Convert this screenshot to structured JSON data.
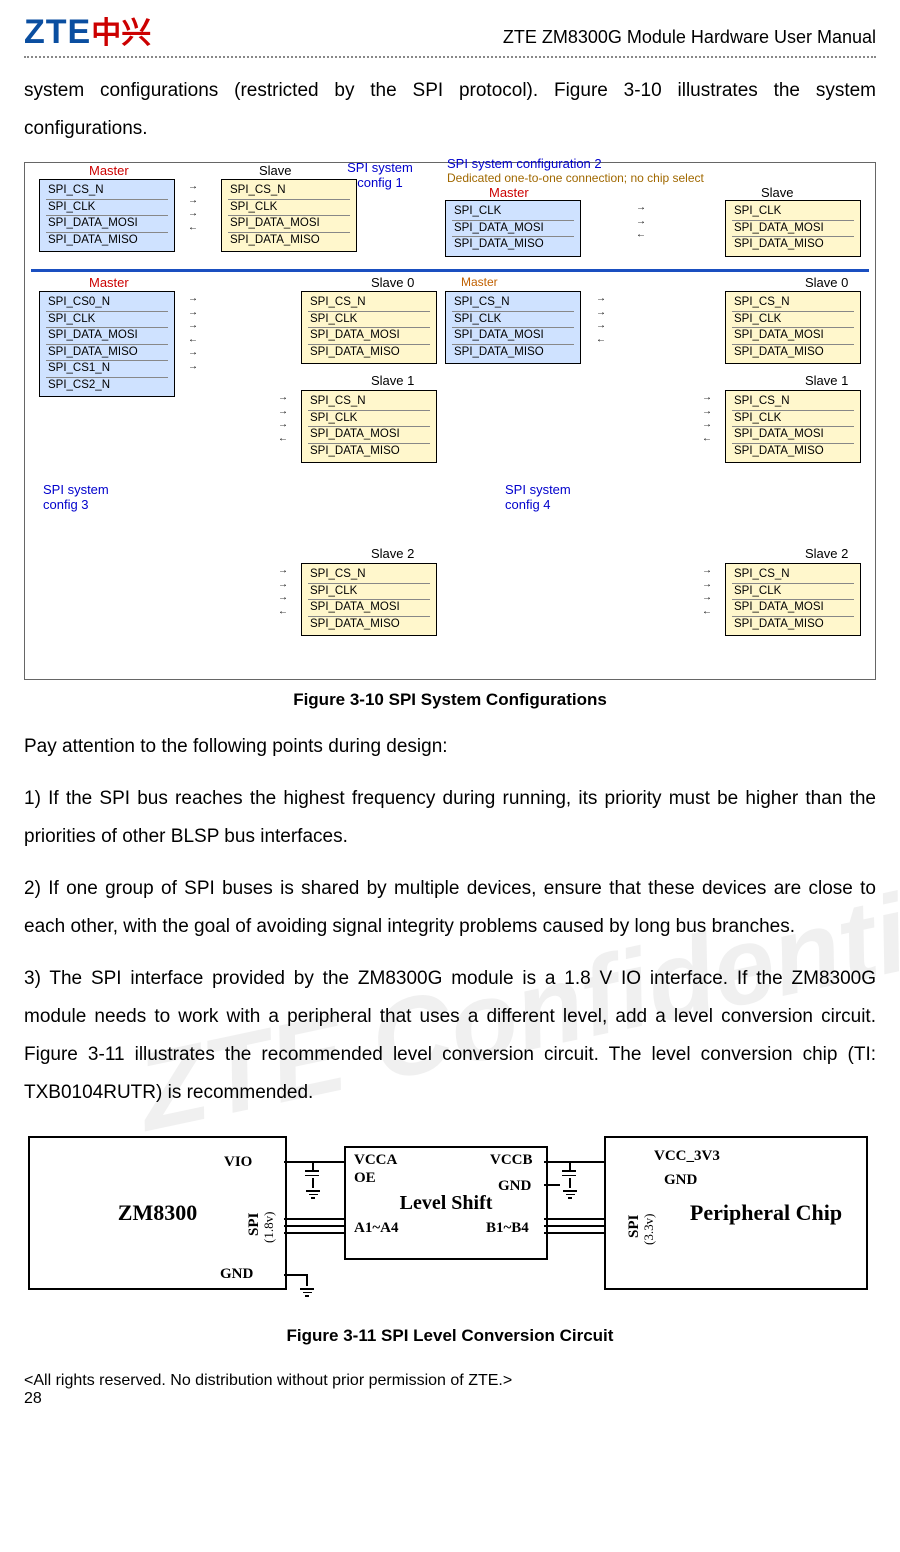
{
  "header": {
    "logo_latin": "ZTE",
    "logo_cn": "中兴",
    "doc_title": "ZTE ZM8300G Module Hardware User Manual"
  },
  "watermark": "ZTE Confidential",
  "intro_para": "system configurations (restricted by the SPI protocol). Figure 3-10 illustrates the system configurations.",
  "fig310_caption": "Figure 3-10 SPI System Configurations",
  "fig311_caption": "Figure 3-11 SPI Level Conversion Circuit",
  "design_intro": "Pay attention to the following points during design:",
  "point1": "1)    If the SPI bus reaches the highest frequency during running, its priority must be higher than the priorities of other BLSP bus interfaces.",
  "point2": "2)    If one group of SPI buses is shared by multiple devices, ensure that these devices are close to each other, with the goal of avoiding signal integrity problems caused by long bus branches.",
  "point3": "3)    The SPI interface provided by the ZM8300G module is a 1.8 V IO interface. If the ZM8300G module needs to work with a peripheral that uses a different level, add a level conversion circuit. Figure 3-11 illustrates the recommended level conversion circuit. The level conversion chip (TI: TXB0104RUTR) is recommended.",
  "footer": {
    "rights": "<All rights reserved. No distribution without prior permission of ZTE.>",
    "page": "28"
  },
  "fig310": {
    "label_master": "Master",
    "label_slave": "Slave",
    "label_slave0": "Slave 0",
    "label_slave1": "Slave 1",
    "label_slave2": "Slave 2",
    "config1": "SPI system config 1",
    "config2_a": "SPI system configuration 2",
    "config2_b": "Dedicated one-to-one connection; no chip select",
    "config3": "SPI system config 3",
    "config4": "SPI system config 4",
    "pins4": [
      "SPI_CS_N",
      "SPI_CLK",
      "SPI_DATA_MOSI",
      "SPI_DATA_MISO"
    ],
    "pins3": [
      "SPI_CLK",
      "SPI_DATA_MOSI",
      "SPI_DATA_MISO"
    ],
    "pins6": [
      "SPI_CS0_N",
      "SPI_CLK",
      "SPI_DATA_MOSI",
      "SPI_DATA_MISO",
      "SPI_CS1_N",
      "SPI_CS2_N"
    ],
    "arrows_rlrl": "→ ← → ←",
    "arrows_lrl": "← → ←"
  },
  "fig311": {
    "zm": "ZM8300",
    "zm_vio": "VIO",
    "zm_spi": "SPI",
    "zm_v": "(1.8v)",
    "zm_gnd": "GND",
    "ls_title": "Level Shift",
    "ls_vcca": "VCCA",
    "ls_oe": "OE",
    "ls_a": "A1~A4",
    "ls_vccb": "VCCB",
    "ls_gnd": "GND",
    "ls_b": "B1~B4",
    "pc_title": "Peripheral Chip",
    "pc_vcc": "VCC_3V3",
    "pc_gnd": "GND",
    "pc_spi": "SPI",
    "pc_v": "(3.3v)"
  }
}
